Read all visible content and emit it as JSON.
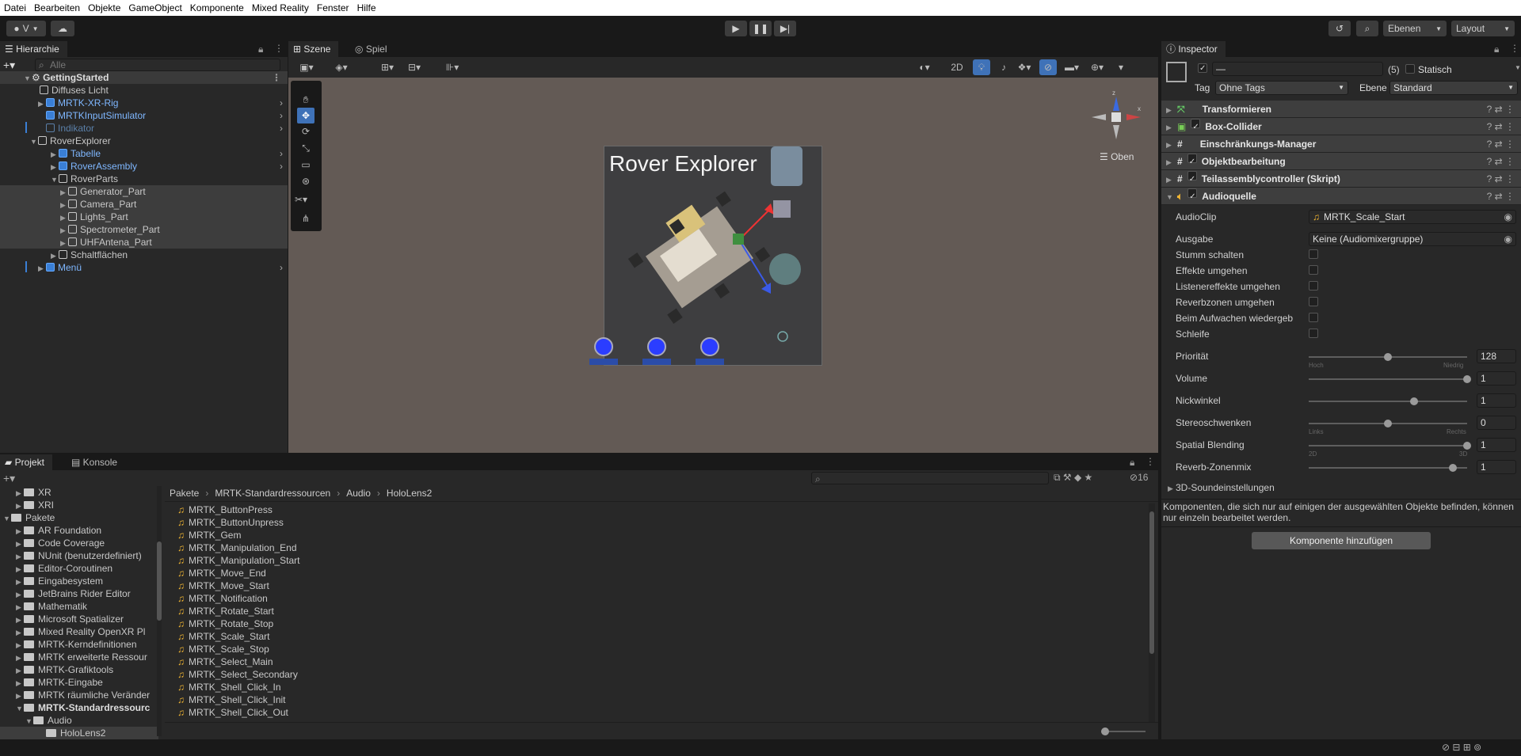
{
  "menu": [
    "Datei",
    "Bearbeiten",
    "Objekte",
    "GameObject",
    "Komponente",
    "Mixed Reality",
    "Fenster",
    "Hilfe"
  ],
  "toolbar": {
    "account": "V",
    "layers": "Ebenen",
    "layout": "Layout"
  },
  "hierarchy": {
    "tab": "Hierarchie",
    "search_placeholder": "Alle",
    "items": [
      {
        "label": "GettingStarted"
      },
      {
        "label": "Diffuses Licht"
      },
      {
        "label": "MRTK-XR-Rig"
      },
      {
        "label": "MRTKInputSimulator"
      },
      {
        "label": "Indikator"
      },
      {
        "label": "RoverExplorer"
      },
      {
        "label": "Tabelle"
      },
      {
        "label": "RoverAssembly"
      },
      {
        "label": "RoverParts"
      },
      {
        "label": "Generator_Part"
      },
      {
        "label": "Camera_Part"
      },
      {
        "label": "Lights_Part"
      },
      {
        "label": "Spectrometer_Part"
      },
      {
        "label": "UHFAntena_Part"
      },
      {
        "label": "Schaltflächen"
      },
      {
        "label": "Menü"
      }
    ]
  },
  "scene": {
    "tab_scene": "Szene",
    "tab_game": "Spiel",
    "mode_2d": "2D",
    "title": "Rover Explorer",
    "gizmo_view": "Oben",
    "axis_x": "x",
    "axis_z": "z"
  },
  "inspector": {
    "tab": "Inspector",
    "name_value": "—",
    "count": "(5)",
    "static_label": "Statisch",
    "tag_label": "Tag",
    "tag_value": "Ohne Tags",
    "layer_label": "Ebene",
    "layer_value": "Standard",
    "components": [
      {
        "label": "Transformieren"
      },
      {
        "label": "Box-Collider"
      },
      {
        "label": "Einschränkungs-Manager"
      },
      {
        "label": "Objektbearbeitung"
      },
      {
        "label": "Teilassemblycontroller (Skript)"
      },
      {
        "label": "Audioquelle"
      }
    ],
    "audio": {
      "audioclip_label": "AudioClip",
      "audioclip_value": "MRTK_Scale_Start",
      "output_label": "Ausgabe",
      "output_value": "Keine (Audiomixergruppe)",
      "mute": "Stumm schalten",
      "bypass_effects": "Effekte umgehen",
      "bypass_listener": "Listenereffekte umgehen",
      "bypass_reverb": "Reverbzonen umgehen",
      "play_on_awake": "Beim Aufwachen wiedergeb",
      "loop": "Schleife",
      "priority_label": "Priorität",
      "priority_value": "128",
      "priority_min": "Hoch",
      "priority_max": "Niedrig",
      "volume_label": "Volume",
      "volume_value": "1",
      "pitch_label": "Nickwinkel",
      "pitch_value": "1",
      "stereo_label": "Stereoschwenken",
      "stereo_value": "0",
      "stereo_min": "Links",
      "stereo_max": "Rechts",
      "spatial_label": "Spatial Blending",
      "spatial_value": "1",
      "spatial_min": "2D",
      "spatial_max": "3D",
      "reverb_label": "Reverb-Zonenmix",
      "reverb_value": "1",
      "sound3d": "3D-Soundeinstellungen"
    },
    "notice": "Komponenten, die sich nur auf einigen der ausgewählten Objekte befinden, können nur einzeln bearbeitet werden.",
    "add_component": "Komponente hinzufügen"
  },
  "project": {
    "tab_project": "Projekt",
    "tab_console": "Konsole",
    "hidden_count": "16",
    "tree": [
      {
        "label": "XR"
      },
      {
        "label": "XRI"
      },
      {
        "label": "Pakete"
      },
      {
        "label": "AR Foundation"
      },
      {
        "label": "Code Coverage"
      },
      {
        "label": "NUnit (benutzerdefiniert)"
      },
      {
        "label": "Editor-Coroutinen"
      },
      {
        "label": "Eingabesystem"
      },
      {
        "label": "JetBrains Rider Editor"
      },
      {
        "label": "Mathematik"
      },
      {
        "label": "Microsoft Spatializer"
      },
      {
        "label": "Mixed Reality OpenXR Pl"
      },
      {
        "label": "MRTK-Kerndefinitionen"
      },
      {
        "label": "MRTK erweiterte Ressour"
      },
      {
        "label": "MRTK-Grafiktools"
      },
      {
        "label": "MRTK-Eingabe"
      },
      {
        "label": "MRTK räumliche Veränder"
      },
      {
        "label": "MRTK-Standardressourc"
      },
      {
        "label": "Audio"
      },
      {
        "label": "HoloLens2"
      }
    ],
    "breadcrumb": [
      "Pakete",
      "MRTK-Standardressourcen",
      "Audio",
      "HoloLens2"
    ],
    "files": [
      "MRTK_ButtonPress",
      "MRTK_ButtonUnpress",
      "MRTK_Gem",
      "MRTK_Manipulation_End",
      "MRTK_Manipulation_Start",
      "MRTK_Move_End",
      "MRTK_Move_Start",
      "MRTK_Notification",
      "MRTK_Rotate_Start",
      "MRTK_Rotate_Stop",
      "MRTK_Scale_Start",
      "MRTK_Scale_Stop",
      "MRTK_Select_Main",
      "MRTK_Select_Secondary",
      "MRTK_Shell_Click_In",
      "MRTK_Shell_Click_Init",
      "MRTK_Shell_Click_Out"
    ]
  }
}
